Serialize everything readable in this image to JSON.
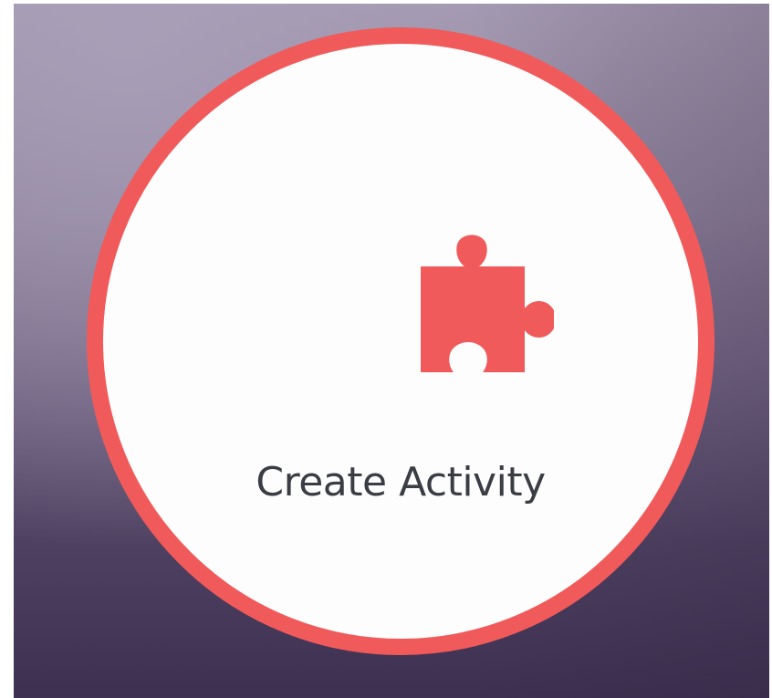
{
  "tile": {
    "label": "Create Activity",
    "icon": "puzzle-piece-icon",
    "accent_color": "#f15a5a",
    "face_color": "#fdfdfd",
    "text_color": "#3b3d45"
  }
}
